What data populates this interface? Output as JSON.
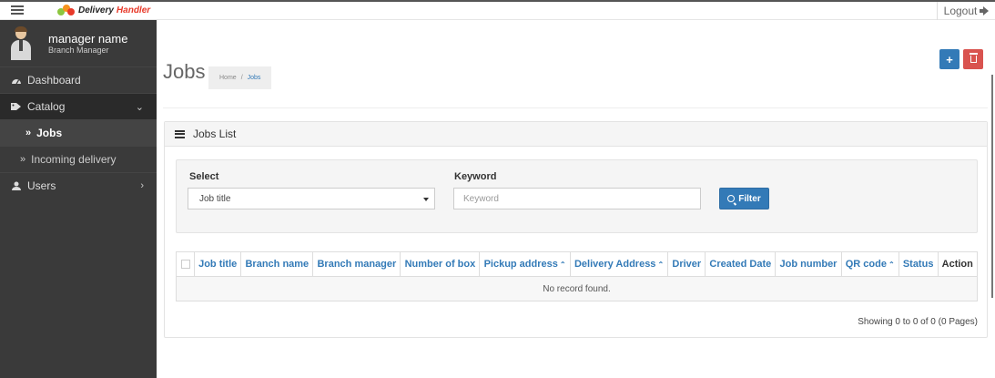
{
  "header": {
    "brand_part1": "Delivery",
    "brand_part2": "Handler",
    "logout_label": "Logout"
  },
  "sidebar": {
    "user_name": "manager name",
    "user_role": "Branch Manager",
    "items": [
      {
        "label": "Dashboard",
        "icon": "dashboard-icon"
      },
      {
        "label": "Catalog",
        "icon": "tag-icon"
      },
      {
        "label": "Jobs",
        "icon": "double-chevron-right-icon"
      },
      {
        "label": "Incoming delivery",
        "icon": "double-chevron-right-icon"
      },
      {
        "label": "Users",
        "icon": "user-icon"
      }
    ]
  },
  "page": {
    "title": "Jobs",
    "breadcrumb_home": "Home",
    "breadcrumb_sep": "/",
    "breadcrumb_current": "Jobs",
    "add_icon": "plus-icon",
    "delete_icon": "trash-icon"
  },
  "panel": {
    "title": "Jobs List",
    "icon": "list-icon"
  },
  "filter": {
    "select_label": "Select",
    "select_value": "Job title",
    "keyword_label": "Keyword",
    "keyword_placeholder": "Keyword",
    "keyword_value": "",
    "button_label": "Filter"
  },
  "table": {
    "columns": [
      "Job title",
      "Branch name",
      "Branch manager",
      "Number of box",
      "Pickup address",
      "Delivery Address",
      "Driver",
      "Created Date",
      "Job number",
      "QR code",
      "Status",
      "Action"
    ],
    "empty_message": "No record found.",
    "sort_indicator": "^"
  },
  "pagination": {
    "summary": "Showing 0 to 0 of 0 (0 Pages)"
  },
  "colors": {
    "primary": "#337ab7",
    "danger": "#d9534f",
    "sidebar_bg": "#3a3a3a"
  }
}
